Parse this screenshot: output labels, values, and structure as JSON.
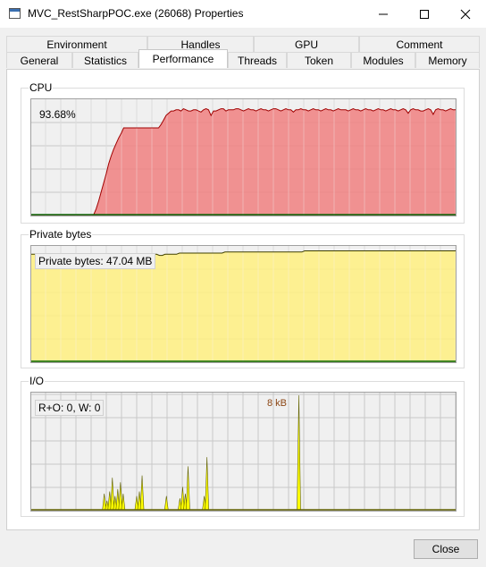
{
  "window": {
    "title": "MVC_RestSharpPOC.exe (26068) Properties"
  },
  "tabs_row1": [
    "Environment",
    "Handles",
    "GPU",
    "Comment"
  ],
  "tabs_row2": [
    "General",
    "Statistics",
    "Performance",
    "Threads",
    "Token",
    "Modules",
    "Memory"
  ],
  "active_tab": "Performance",
  "cpu": {
    "label": "CPU",
    "value": "93.68%",
    "fill_color": "#f08080",
    "line_color": "#a00000",
    "samples_percent": [
      0,
      0,
      0,
      0,
      0,
      0,
      0,
      0,
      0,
      0,
      0,
      0,
      0,
      0,
      0,
      0,
      0,
      0,
      0,
      0,
      0,
      0,
      0,
      0,
      0,
      0,
      5,
      12,
      20,
      28,
      36,
      45,
      52,
      58,
      63,
      68,
      72,
      77,
      77,
      77,
      77,
      77,
      77,
      77,
      77,
      77,
      77,
      77,
      77,
      77,
      77,
      77,
      80,
      84,
      88,
      90,
      92,
      92,
      93,
      93,
      92,
      94,
      93,
      92,
      92,
      93,
      93,
      92,
      91,
      93,
      94,
      93,
      88,
      92,
      92,
      93,
      94,
      94,
      92,
      93,
      93,
      93,
      94,
      94,
      93,
      92,
      93,
      94,
      93,
      93,
      92,
      93,
      94,
      93,
      93,
      92,
      93,
      94,
      94,
      93,
      92,
      93,
      94,
      93,
      93,
      91,
      93,
      93,
      94,
      93,
      93,
      92,
      93,
      94,
      93,
      93,
      92,
      93,
      94,
      93,
      93,
      92,
      93,
      94,
      93,
      93,
      93,
      92,
      93,
      94,
      93,
      93,
      92,
      93,
      94,
      93,
      93,
      92,
      93,
      94,
      93,
      93,
      92,
      93,
      94,
      93,
      93,
      92,
      93,
      94,
      93,
      90,
      93,
      94,
      93,
      93,
      92,
      92,
      93,
      94,
      93,
      89,
      93,
      94,
      93,
      93,
      92,
      93,
      94,
      93,
      93
    ]
  },
  "private_bytes": {
    "label": "Private bytes",
    "value": "Private bytes: 47.04 MB",
    "fill_color": "#fff080",
    "line_color": "#404000",
    "samples_percent": [
      95,
      95,
      95,
      95,
      95,
      95,
      95,
      95,
      95,
      95,
      95,
      95,
      95,
      95,
      95,
      95,
      95,
      95,
      95,
      95,
      95,
      95,
      95,
      95,
      95,
      95,
      95,
      95,
      95,
      95,
      95,
      95,
      95,
      95,
      95,
      95,
      95,
      95,
      95,
      95,
      95,
      95,
      95,
      95,
      95,
      94,
      94,
      95,
      95,
      95,
      95,
      95,
      96,
      96,
      96,
      96,
      96,
      96,
      96,
      96,
      96,
      96,
      96,
      96,
      96,
      96,
      96,
      96,
      97,
      97,
      97,
      97,
      97,
      97,
      97,
      97,
      97,
      97,
      97,
      97,
      97,
      97,
      97,
      97,
      97,
      97,
      97,
      97,
      97,
      97,
      97,
      97,
      97,
      97,
      97,
      97,
      98,
      98,
      98,
      98,
      98,
      98,
      98,
      98,
      98,
      98,
      98,
      98,
      98,
      98,
      98,
      98,
      98,
      98,
      98,
      98,
      98,
      98,
      98,
      98,
      98,
      98,
      98,
      98,
      98,
      98,
      98,
      98,
      98,
      98,
      98,
      98,
      98,
      98,
      98,
      98,
      98,
      98,
      98,
      98,
      98,
      98,
      98,
      98,
      98,
      98,
      98,
      98,
      98,
      98
    ]
  },
  "io": {
    "label": "I/O",
    "value": "R+O: 0, W: 0",
    "peak_label": "8 kB",
    "fill_color": "#ffff00",
    "line_color": "#606000",
    "samples_percent": [
      0,
      0,
      0,
      0,
      0,
      0,
      0,
      0,
      0,
      0,
      0,
      0,
      0,
      0,
      0,
      0,
      0,
      0,
      0,
      0,
      0,
      0,
      0,
      0,
      0,
      0,
      0,
      14,
      8,
      16,
      28,
      12,
      18,
      24,
      14,
      0,
      0,
      0,
      0,
      12,
      16,
      30,
      0,
      0,
      0,
      0,
      0,
      0,
      0,
      0,
      12,
      0,
      0,
      0,
      0,
      10,
      20,
      14,
      38,
      0,
      0,
      0,
      0,
      0,
      12,
      46,
      0,
      0,
      0,
      0,
      0,
      0,
      0,
      0,
      0,
      0,
      0,
      0,
      0,
      0,
      0,
      0,
      0,
      0,
      0,
      0,
      0,
      0,
      0,
      0,
      0,
      0,
      0,
      0,
      0,
      0,
      0,
      0,
      0,
      100,
      0,
      0,
      0,
      0,
      0,
      0,
      0,
      0,
      0,
      0,
      0,
      0,
      0,
      0,
      0,
      0,
      0,
      0,
      0,
      0,
      0,
      0,
      0,
      0,
      0,
      0,
      0,
      0,
      0,
      0,
      0,
      0,
      0,
      0,
      0,
      0,
      0,
      0,
      0,
      0,
      0,
      0,
      0,
      0,
      0,
      0,
      0,
      0,
      0,
      0,
      0,
      0,
      0,
      0,
      0,
      0,
      0,
      0
    ]
  },
  "footer": {
    "close_label": "Close"
  }
}
